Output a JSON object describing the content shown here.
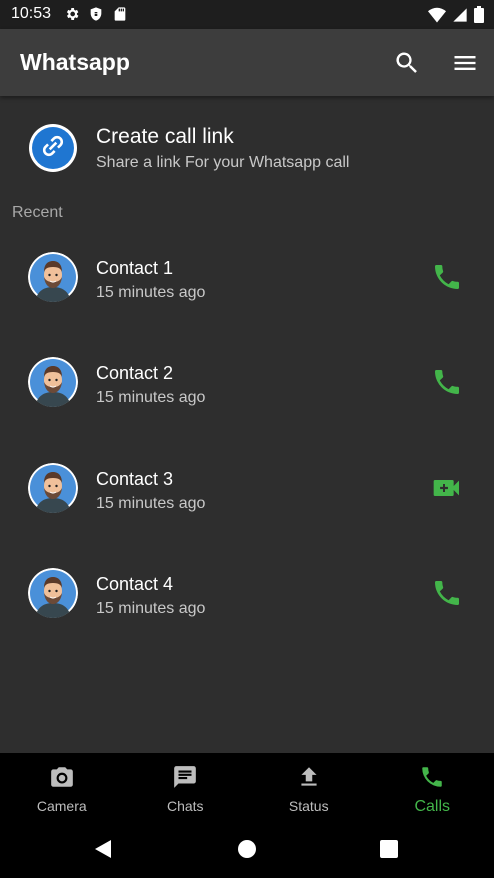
{
  "status_bar": {
    "time": "10:53",
    "left_icons": [
      "gear-icon",
      "shield-icon",
      "sd-card-icon"
    ],
    "right_icons": [
      "wifi-icon",
      "cell-signal-icon",
      "battery-icon"
    ]
  },
  "app_bar": {
    "title": "Whatsapp",
    "actions": [
      "search-icon",
      "menu-icon"
    ]
  },
  "call_link": {
    "title": "Create call link",
    "subtitle": "Share a link For your Whatsapp call",
    "icon": "link-icon"
  },
  "recent_label": "Recent",
  "contacts": [
    {
      "name": "Contact 1",
      "time": "15 minutes ago",
      "call_type": "phone"
    },
    {
      "name": "Contact 2",
      "time": "15 minutes ago",
      "call_type": "phone"
    },
    {
      "name": "Contact 3",
      "time": "15 minutes ago",
      "call_type": "video"
    },
    {
      "name": "Contact 4",
      "time": "15 minutes ago",
      "call_type": "phone"
    }
  ],
  "bottom_nav": {
    "items": [
      {
        "label": "Camera",
        "icon": "camera-icon",
        "active": false
      },
      {
        "label": "Chats",
        "icon": "chat-icon",
        "active": false
      },
      {
        "label": "Status",
        "icon": "upload-icon",
        "active": false
      },
      {
        "label": "Calls",
        "icon": "phone-icon",
        "active": true
      }
    ]
  },
  "system_nav": [
    "back-icon",
    "home-icon",
    "recents-icon"
  ],
  "colors": {
    "accent_green": "#43b54a",
    "app_bar": "#3d3d3d",
    "background": "#2e2e2e",
    "link_blue": "#1f76d1"
  }
}
